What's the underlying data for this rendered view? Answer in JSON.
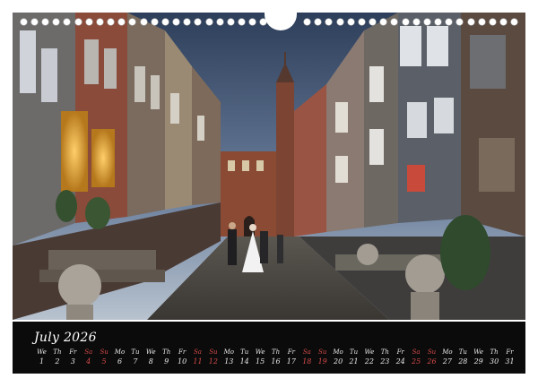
{
  "calendar": {
    "month_label": "July 2026",
    "weekday_abbrevs": [
      "We",
      "Th",
      "Fr",
      "Sa",
      "Su",
      "Mo",
      "Tu",
      "We",
      "Th",
      "Fr",
      "Sa",
      "Su",
      "Mo",
      "Tu",
      "We",
      "Th",
      "Fr",
      "Sa",
      "Su",
      "Mo",
      "Tu",
      "We",
      "Th",
      "Fr",
      "Sa",
      "Su",
      "Mo",
      "Tu",
      "We",
      "Th",
      "Fr"
    ],
    "days": [
      "1",
      "2",
      "3",
      "4",
      "5",
      "6",
      "7",
      "8",
      "9",
      "10",
      "11",
      "12",
      "13",
      "14",
      "15",
      "16",
      "17",
      "18",
      "19",
      "20",
      "21",
      "22",
      "23",
      "24",
      "25",
      "26",
      "27",
      "28",
      "29",
      "30",
      "31"
    ],
    "weekend_flags": [
      0,
      0,
      0,
      1,
      1,
      0,
      0,
      0,
      0,
      0,
      1,
      1,
      0,
      0,
      0,
      0,
      0,
      1,
      1,
      0,
      0,
      0,
      0,
      0,
      1,
      1,
      0,
      0,
      0,
      0,
      0
    ],
    "colors": {
      "weekend": "#d84a4a",
      "weekday": "#eaeaea",
      "strip": "#0b0b0b"
    }
  },
  "binding": {
    "hole_count": 46
  }
}
